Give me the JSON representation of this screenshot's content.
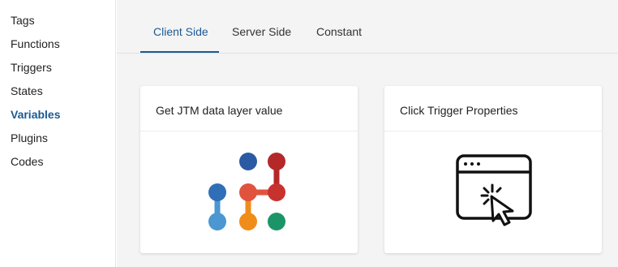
{
  "sidebar": {
    "items": [
      {
        "label": "Tags",
        "active": false
      },
      {
        "label": "Functions",
        "active": false
      },
      {
        "label": "Triggers",
        "active": false
      },
      {
        "label": "States",
        "active": false
      },
      {
        "label": "Variables",
        "active": true
      },
      {
        "label": "Plugins",
        "active": false
      },
      {
        "label": "Codes",
        "active": false
      }
    ]
  },
  "tabs": [
    {
      "label": "Client Side",
      "active": true
    },
    {
      "label": "Server Side",
      "active": false
    },
    {
      "label": "Constant",
      "active": false
    }
  ],
  "cards": [
    {
      "title": "Get JTM data layer value",
      "icon": "jtm-logo-icon"
    },
    {
      "title": "Click Trigger Properties",
      "icon": "browser-click-icon"
    }
  ],
  "colors": {
    "accent": "#1a5a96",
    "background": "#f4f4f4",
    "logo_dark_blue": "#2b5aa5",
    "logo_red": "#b5282a",
    "logo_orange_red": "#e0543d",
    "logo_blue": "#2f6fb7",
    "logo_light_blue": "#4a97d1",
    "logo_orange": "#f08c1a",
    "logo_green": "#1b9568"
  }
}
